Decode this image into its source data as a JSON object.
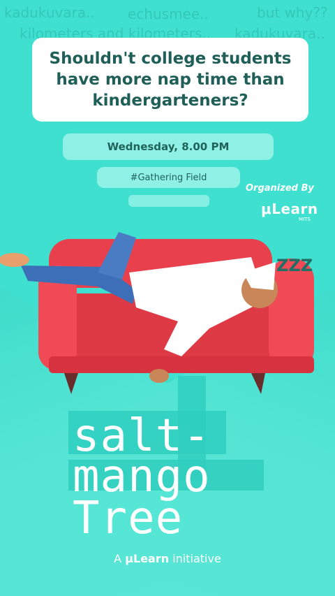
{
  "background_words": [
    "kadukuvara..",
    "echusmee..",
    "but why??",
    "kilometers and kilometers..",
    "kadukuvara.."
  ],
  "question": "Shouldn't college students have more nap time than kindergarteners?",
  "event": {
    "date_time": "Wednesday, 8.00 PM",
    "venue": "#Gathering Field"
  },
  "organizer": {
    "label": "Organized By",
    "logo": "μLearn",
    "chapter": "MITS"
  },
  "sleep_text": "ZZZ",
  "title": {
    "line1": "salt-",
    "line2": "mango",
    "line3": "Tree"
  },
  "footer": {
    "prefix": "A",
    "brand": "μLearn",
    "suffix": "initiative"
  },
  "colors": {
    "background": "#3fe0cf",
    "text_dark": "#1f5f58",
    "pill": "#8ff1e6",
    "sofa": "#e8414d"
  }
}
